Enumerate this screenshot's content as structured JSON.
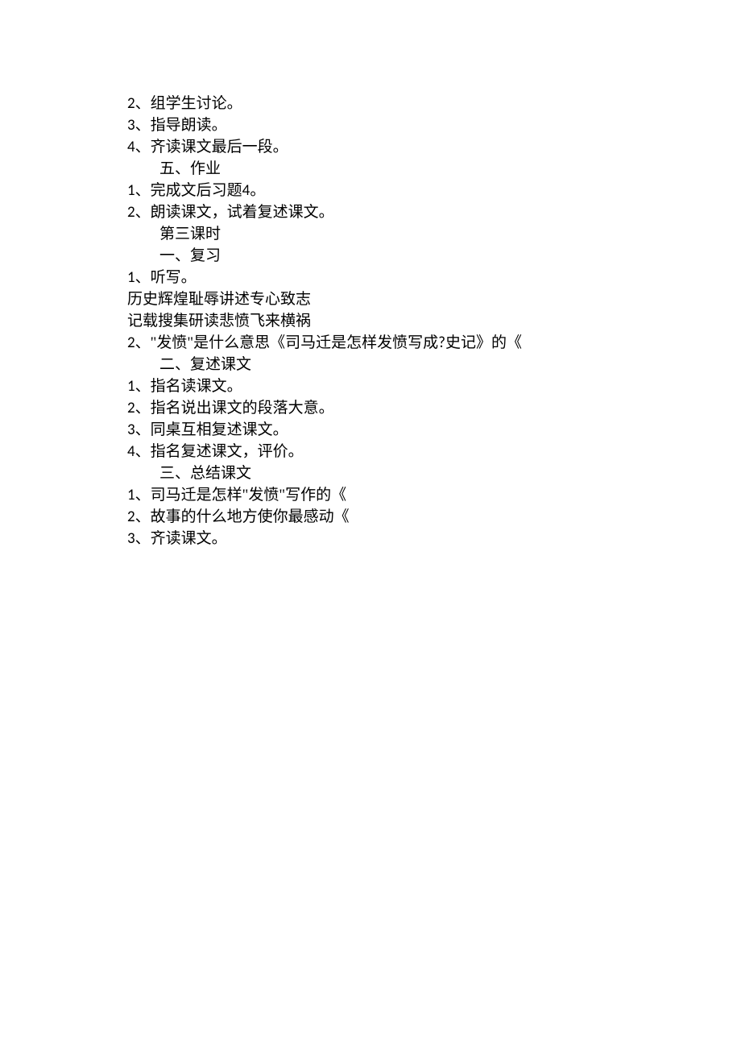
{
  "lines": [
    {
      "indent": "indent1",
      "prefixNum": "2",
      "prefixPunct": "、",
      "text": "组学生讨论。"
    },
    {
      "indent": "indent1",
      "prefixNum": "3",
      "prefixPunct": "、",
      "text": "指导朗读。"
    },
    {
      "indent": "indent1",
      "prefixNum": "4",
      "prefixPunct": "、",
      "text": "齐读课文最后一段。"
    },
    {
      "indent": "indent2",
      "prefixNum": "",
      "prefixPunct": "",
      "text": "五、作业"
    },
    {
      "indent": "indent1",
      "prefixNum": "1",
      "prefixPunct": "、",
      "text": "完成文后习题",
      "suffixNum": "4",
      "suffixText": "。"
    },
    {
      "indent": "indent1",
      "prefixNum": "2",
      "prefixPunct": "、",
      "text": "朗读课文，试着复述课文。"
    },
    {
      "indent": "indent2",
      "prefixNum": "",
      "prefixPunct": "",
      "text": "第三课时"
    },
    {
      "indent": "indent2",
      "prefixNum": "",
      "prefixPunct": "",
      "text": "一、复习"
    },
    {
      "indent": "indent1",
      "prefixNum": "1",
      "prefixPunct": "、",
      "text": "听写。"
    },
    {
      "indent": "indent1",
      "prefixNum": "",
      "prefixPunct": "",
      "text": "历史辉煌耻辱讲述专心致志"
    },
    {
      "indent": "indent1",
      "prefixNum": "",
      "prefixPunct": "",
      "text": "记载搜集研读悲愤飞来横祸"
    },
    {
      "indent": "indent1",
      "prefixNum": "2",
      "prefixPunct": "、",
      "text": "\"发愤\"是什么意思《司马迁是怎样发愤写成",
      "suffixNum": "?",
      "suffixText": "史记》的《"
    },
    {
      "indent": "indent2",
      "prefixNum": "",
      "prefixPunct": "",
      "text": "二、复述课文"
    },
    {
      "indent": "indent1",
      "prefixNum": "1",
      "prefixPunct": "、",
      "text": "指名读课文。"
    },
    {
      "indent": "indent1",
      "prefixNum": "2",
      "prefixPunct": "、",
      "text": "指名说出课文的段落大意。"
    },
    {
      "indent": "indent1",
      "prefixNum": "3",
      "prefixPunct": "、",
      "text": "同桌互相复述课文。"
    },
    {
      "indent": "indent1",
      "prefixNum": "4",
      "prefixPunct": "、",
      "text": "指名复述课文，评价。"
    },
    {
      "indent": "indent2",
      "prefixNum": "",
      "prefixPunct": "",
      "text": "三、总结课文"
    },
    {
      "indent": "indent1",
      "prefixNum": "1",
      "prefixPunct": "、",
      "text": "司马迁是怎样\"发愤\"写作的《"
    },
    {
      "indent": "indent1",
      "prefixNum": "2",
      "prefixPunct": "、",
      "text": "故事的什么地方使你最感动《"
    },
    {
      "indent": "indent1",
      "prefixNum": "3",
      "prefixPunct": "、",
      "text": "齐读课文。"
    }
  ]
}
